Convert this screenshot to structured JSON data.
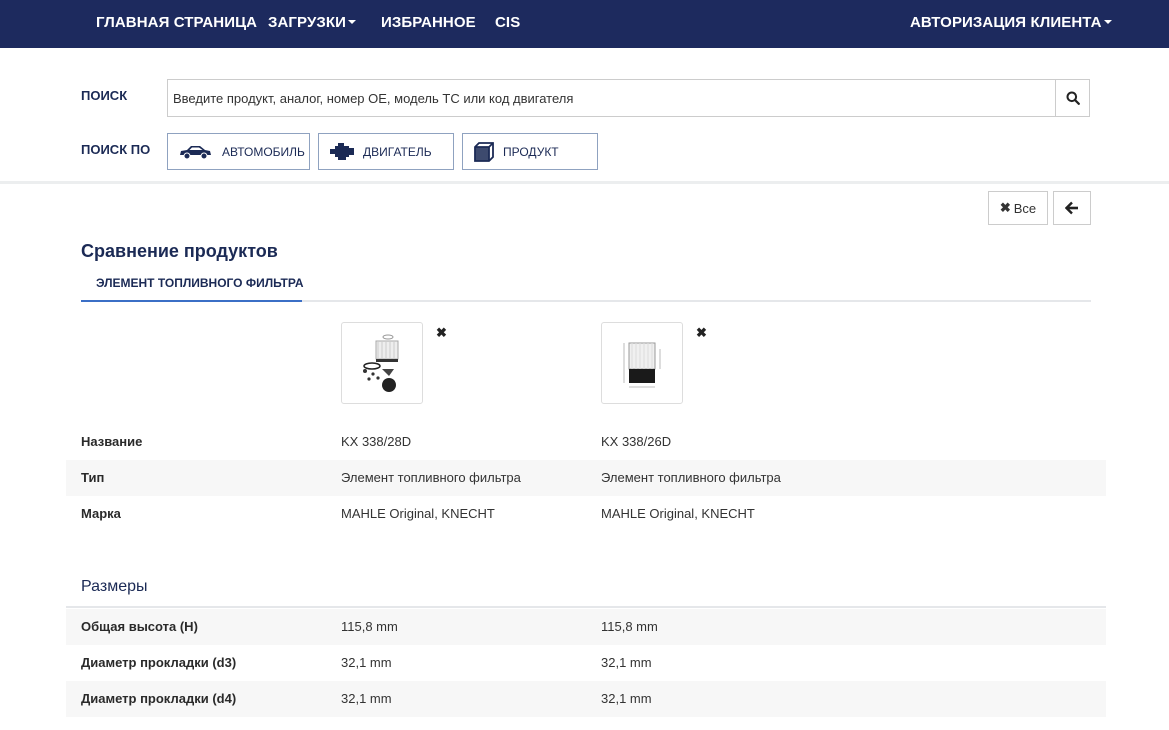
{
  "nav": {
    "items": [
      {
        "label": "ГЛАВНАЯ СТРАНИЦА"
      },
      {
        "label": "ЗАГРУЗКИ"
      },
      {
        "label": "ИЗБРАННОЕ"
      },
      {
        "label": "CIS"
      }
    ],
    "login_label": "АВТОРИЗАЦИЯ КЛИЕНТА"
  },
  "search": {
    "label": "ПОИСК",
    "placeholder": "Введите продукт, аналог, номер OE, модель ТС или код двигателя",
    "by_label": "ПОИСК ПО",
    "by_buttons": [
      {
        "label": "АВТОМОБИЛЬ",
        "icon": "car-icon"
      },
      {
        "label": "ДВИГАТЕЛЬ",
        "icon": "engine-icon"
      },
      {
        "label": "ПРОДУКТ",
        "icon": "box-icon"
      }
    ]
  },
  "toolbar": {
    "clear_all_label": "Все",
    "back_icon": "arrow-left-icon"
  },
  "page": {
    "title": "Сравнение продуктов",
    "active_tab": "ЭЛЕМЕНТ ТОПЛИВНОГО ФИЛЬТРА"
  },
  "products": [
    {
      "name": "KX 338/28D",
      "type": "Элемент топливного фильтра",
      "brand": "MAHLE Original, KNECHT"
    },
    {
      "name": "KX 338/26D",
      "type": "Элемент топливного фильтра",
      "brand": "MAHLE Original, KNECHT"
    }
  ],
  "general_rows": [
    {
      "label": "Название",
      "values": [
        "KX 338/28D",
        "KX 338/26D"
      ]
    },
    {
      "label": "Тип",
      "values": [
        "Элемент топливного фильтра",
        "Элемент топливного фильтра"
      ]
    },
    {
      "label": "Марка",
      "values": [
        "MAHLE Original, KNECHT",
        "MAHLE Original, KNECHT"
      ]
    }
  ],
  "dimensions": {
    "title": "Размеры",
    "rows": [
      {
        "label": "Общая высота (H)",
        "values": [
          "115,8 mm",
          "115,8 mm"
        ]
      },
      {
        "label": "Диаметр прокладки (d3)",
        "values": [
          "32,1 mm",
          "32,1 mm"
        ]
      },
      {
        "label": "Диаметр прокладки (d4)",
        "values": [
          "32,1 mm",
          "32,1 mm"
        ]
      }
    ]
  },
  "colors": {
    "nav_bg": "#1d2a5e",
    "accent": "#3b6fc6",
    "heading": "#1b2a55"
  }
}
